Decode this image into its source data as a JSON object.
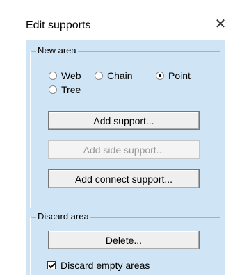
{
  "dialog": {
    "title": "Edit supports",
    "close_glyph": "✕"
  },
  "new_area": {
    "legend": "New area",
    "radios": [
      {
        "label": "Web",
        "selected": false
      },
      {
        "label": "Chain",
        "selected": false
      },
      {
        "label": "Point",
        "selected": true
      },
      {
        "label": "Tree",
        "selected": false
      }
    ],
    "buttons": {
      "add_support": "Add support...",
      "add_side_support": "Add side support...",
      "add_connect_support": "Add connect support..."
    }
  },
  "discard_area": {
    "legend": "Discard area",
    "delete_label": "Delete...",
    "discard_empty_label": "Discard empty areas",
    "discard_empty_checked": true
  },
  "colors": {
    "panel": "#cfe4f5"
  }
}
